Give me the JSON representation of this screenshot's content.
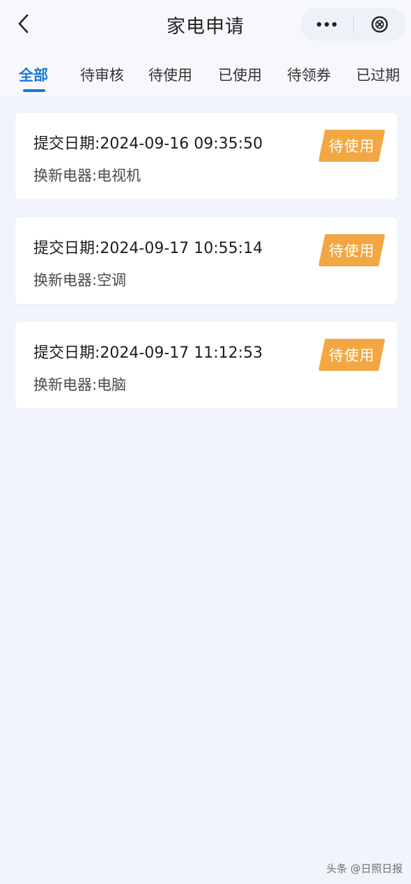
{
  "header": {
    "title": "家电申请",
    "back_icon": "chevron-left-icon",
    "more_icon": "more-dots-icon",
    "close_icon": "close-circle-icon"
  },
  "tabs": [
    {
      "label": "全部",
      "active": true
    },
    {
      "label": "待审核",
      "active": false
    },
    {
      "label": "待使用",
      "active": false
    },
    {
      "label": "已使用",
      "active": false
    },
    {
      "label": "待领券",
      "active": false
    },
    {
      "label": "已过期",
      "active": false
    }
  ],
  "applications": [
    {
      "date_label": "提交日期:",
      "date": "2024-09-16 09:35:50",
      "appliance_label": "换新电器:",
      "appliance": "电视机",
      "status": "待使用"
    },
    {
      "date_label": "提交日期:",
      "date": "2024-09-17 10:55:14",
      "appliance_label": "换新电器:",
      "appliance": "空调",
      "status": "待使用"
    },
    {
      "date_label": "提交日期:",
      "date": "2024-09-17 11:12:53",
      "appliance_label": "换新电器:",
      "appliance": "电脑",
      "status": "待使用"
    }
  ],
  "watermark": "头条 @日照日报",
  "colors": {
    "accent": "#1976d8",
    "badge": "#f2a742",
    "background": "#f1f5fb"
  }
}
